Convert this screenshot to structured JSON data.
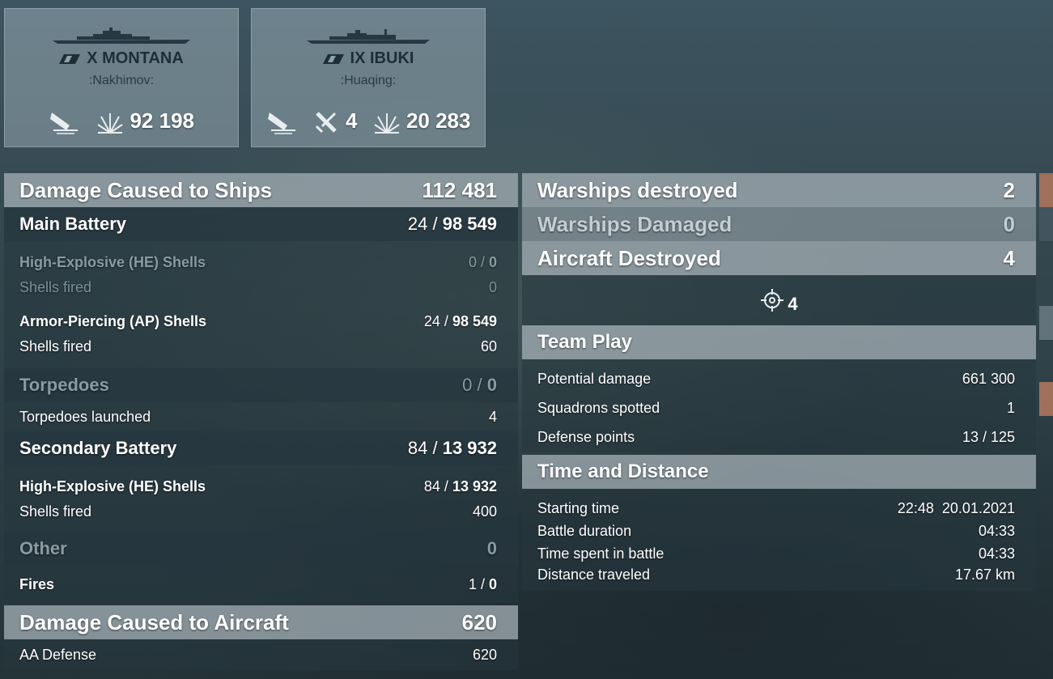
{
  "ships": [
    {
      "name": "X MONTANA",
      "player": ":Nakhimov:",
      "damage": "92 198",
      "planes_shot": ""
    },
    {
      "name": "IX IBUKI",
      "player": ":Huaqing:",
      "damage": "20 283",
      "planes_shot": "4"
    }
  ],
  "damage_ships": {
    "title": "Damage Caused to Ships",
    "total": "112 481",
    "main_battery": {
      "label": "Main Battery",
      "hits": "24",
      "damage": "98 549",
      "he_label": "High-Explosive (HE) Shells",
      "he_hits": "0",
      "he_damage": "0",
      "he_shells_label": "Shells fired",
      "he_shells": "0",
      "ap_label": "Armor-Piercing (AP) Shells",
      "ap_hits": "24",
      "ap_damage": "98 549",
      "ap_shells_label": "Shells fired",
      "ap_shells": "60"
    },
    "torpedoes": {
      "label": "Torpedoes",
      "hits": "0",
      "damage": "0",
      "launched_label": "Torpedoes launched",
      "launched": "4"
    },
    "secondary": {
      "label": "Secondary Battery",
      "hits": "84",
      "damage": "13 932",
      "he_label": "High-Explosive (HE) Shells",
      "he_hits": "84",
      "he_damage": "13 932",
      "shells_label": "Shells fired",
      "shells": "400"
    },
    "other": {
      "label": "Other",
      "total": "0",
      "fires_label": "Fires",
      "fires_count": "1",
      "fires_damage": "0"
    }
  },
  "damage_aircraft": {
    "title": "Damage Caused to Aircraft",
    "total": "620",
    "aa_label": "AA Defense",
    "aa_value": "620"
  },
  "kills": {
    "warships_destroyed_label": "Warships destroyed",
    "warships_destroyed": "2",
    "warships_damaged_label": "Warships Damaged",
    "warships_damaged": "0",
    "aircraft_destroyed_label": "Aircraft Destroyed",
    "aircraft_destroyed": "4",
    "aircraft_kill_count": "4"
  },
  "team_play": {
    "title": "Team Play",
    "potential_label": "Potential damage",
    "potential": "661 300",
    "squadrons_label": "Squadrons spotted",
    "squadrons": "1",
    "defense_label": "Defense points",
    "defense": "13 / 125"
  },
  "time_distance": {
    "title": "Time and Distance",
    "start_label": "Starting time",
    "start": "22:48  20.01.2021",
    "duration_label": "Battle duration",
    "duration": "04:33",
    "in_battle_label": "Time spent in battle",
    "in_battle": "04:33",
    "distance_label": "Distance traveled",
    "distance": "17.67 km"
  },
  "colors": {
    "header_bar": "#a0acb2",
    "sub_header": "#26363e",
    "accent_orange": "#b87a5a"
  }
}
